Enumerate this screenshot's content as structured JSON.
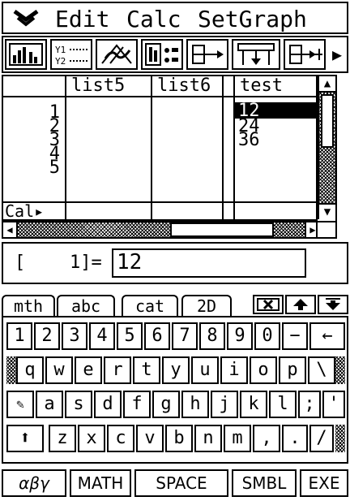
{
  "menu": {
    "arrow_icon": "double-chevron-down",
    "items": [
      "Edit",
      "Calc",
      "SetGraph"
    ]
  },
  "toolbar": {
    "icons": [
      "graph-window-icon",
      "graph-editor-icon",
      "stat-graph-icon",
      "stat-calc-icon",
      "list-insert-icon",
      "sort-icon",
      "list-append-icon",
      "scroll-right-icon"
    ],
    "y1y2_label": "Y1 Y2",
    "arrow_glyph": "▶"
  },
  "table": {
    "columns": [
      "list5",
      "list6",
      "test"
    ],
    "row_numbers": [
      "1",
      "2",
      "3",
      "4",
      "5"
    ],
    "values_test": [
      "12",
      "24",
      "36"
    ],
    "cal_label": "Cal▸"
  },
  "editline": {
    "prefix": "[",
    "index": "1]=",
    "value": "12"
  },
  "keyboard": {
    "tabs": [
      "mth",
      "abc",
      "cat",
      "2D"
    ],
    "row1": [
      "1",
      "2",
      "3",
      "4",
      "5",
      "6",
      "7",
      "8",
      "9",
      "0",
      "−",
      "←"
    ],
    "row2": [
      "q",
      "w",
      "e",
      "r",
      "t",
      "y",
      "u",
      "i",
      "o",
      "p",
      "\\"
    ],
    "row3": [
      "a",
      "s",
      "d",
      "f",
      "g",
      "h",
      "j",
      "k",
      "l",
      ";",
      "'"
    ],
    "row4": [
      "z",
      "x",
      "c",
      "v",
      "b",
      "n",
      "m",
      ",",
      ".",
      "/"
    ],
    "shift_glyph": "⬆",
    "bottom": [
      "αβγ",
      "MATH",
      "SPACE",
      "SMBL",
      "EXE"
    ]
  }
}
